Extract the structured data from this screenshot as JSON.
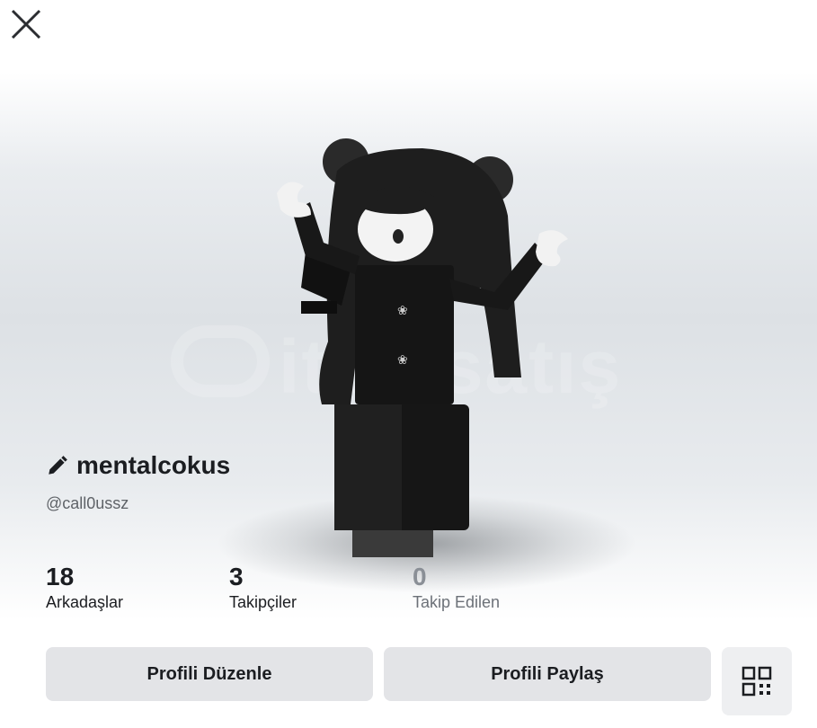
{
  "profile": {
    "display_name": "mentalcokus",
    "username": "@call0ussz"
  },
  "stats": [
    {
      "value": "18",
      "label": "Arkadaşlar"
    },
    {
      "value": "3",
      "label": "Takipçiler"
    },
    {
      "value": "0",
      "label": "Takip Edilen"
    }
  ],
  "actions": {
    "edit_profile": "Profili Düzenle",
    "share_profile": "Profili Paylaş"
  },
  "watermark": "itemsatış",
  "icons": {
    "close": "close-icon",
    "edit": "pencil-icon",
    "qr": "qr-code-icon"
  }
}
